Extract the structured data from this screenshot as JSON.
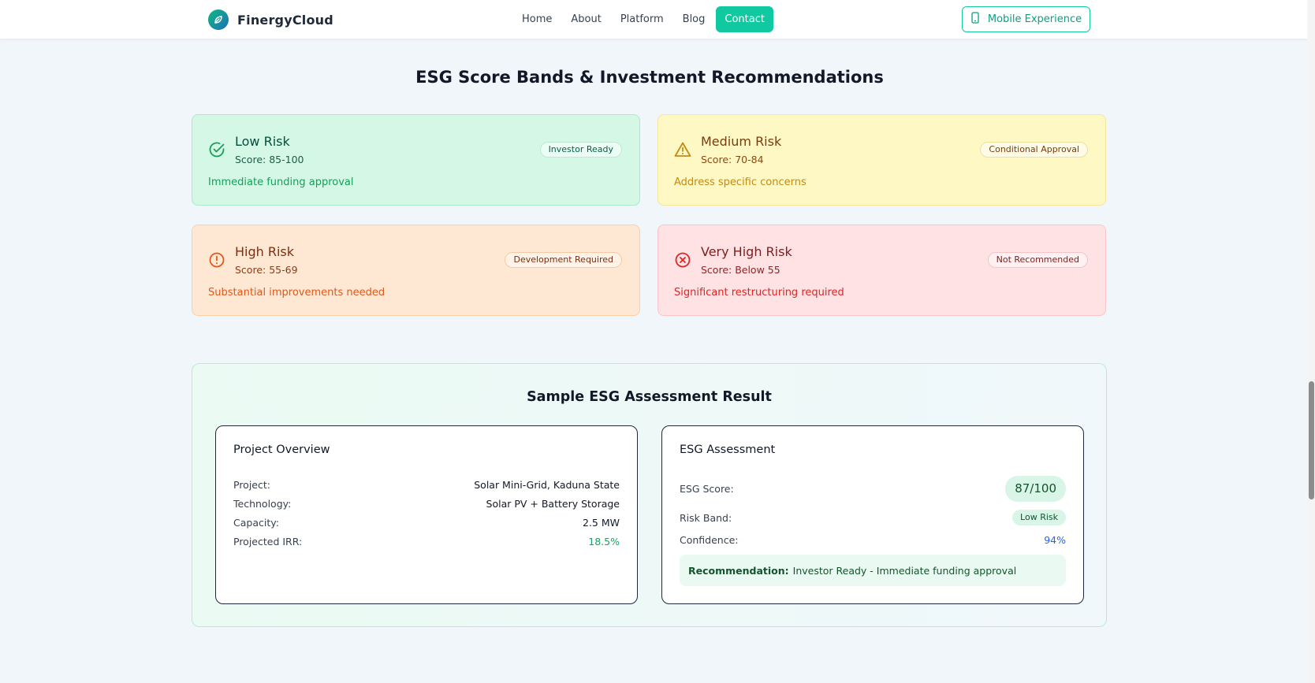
{
  "header": {
    "brand": "FinergyCloud",
    "nav": [
      "Home",
      "About",
      "Platform",
      "Blog"
    ],
    "contact": "Contact",
    "mobile_button": "Mobile Experience"
  },
  "section_title": "ESG Score Bands & Investment Recommendations",
  "risk_bands": [
    {
      "title": "Low Risk",
      "score": "Score: 85-100",
      "description": "Immediate funding approval",
      "badge": "Investor Ready",
      "icon": "check-circle-icon"
    },
    {
      "title": "Medium Risk",
      "score": "Score: 70-84",
      "description": "Address specific concerns",
      "badge": "Conditional Approval",
      "icon": "warning-triangle-icon"
    },
    {
      "title": "High Risk",
      "score": "Score: 55-69",
      "description": "Substantial improvements needed",
      "badge": "Development Required",
      "icon": "alert-circle-icon"
    },
    {
      "title": "Very High Risk",
      "score": "Score: Below 55",
      "description": "Significant restructuring required",
      "badge": "Not Recommended",
      "icon": "x-circle-icon"
    }
  ],
  "sample": {
    "title": "Sample ESG Assessment Result",
    "overview": {
      "title": "Project Overview",
      "rows": [
        {
          "label": "Project:",
          "value": "Solar Mini-Grid, Kaduna State"
        },
        {
          "label": "Technology:",
          "value": "Solar PV + Battery Storage"
        },
        {
          "label": "Capacity:",
          "value": "2.5 MW"
        },
        {
          "label": "Projected IRR:",
          "value": "18.5%"
        }
      ]
    },
    "assessment": {
      "title": "ESG Assessment",
      "score_label": "ESG Score:",
      "score_value": "87/100",
      "band_label": "Risk Band:",
      "band_value": "Low Risk",
      "confidence_label": "Confidence:",
      "confidence_value": "94%",
      "recommendation_label": "Recommendation:",
      "recommendation_text": "Investor Ready - Immediate funding approval"
    }
  },
  "colors": {
    "accent": "#10c9a0",
    "low": "#15a058",
    "medium": "#c58a13",
    "high": "#e0581b",
    "very_high": "#dc2626"
  }
}
